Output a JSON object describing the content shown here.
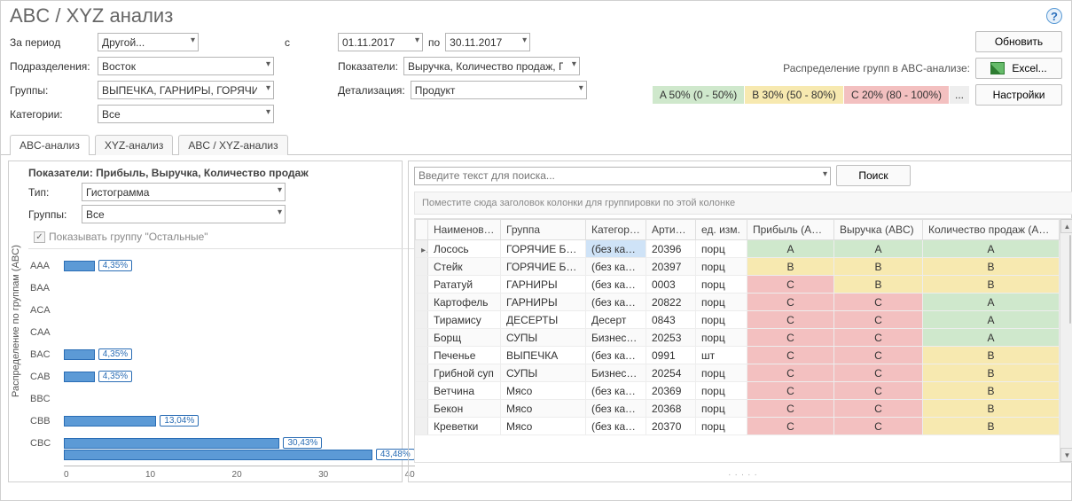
{
  "title": "ABC / XYZ анализ",
  "filters": {
    "period_label": "За период",
    "period_value": "Другой...",
    "from_label": "с",
    "from_value": "01.11.2017",
    "to_label": "по",
    "to_value": "30.11.2017",
    "division_label": "Подразделения:",
    "division_value": "Восток",
    "indicator_label": "Показатели:",
    "indicator_value": "Выручка, Количество продаж, П...",
    "groups_label": "Группы:",
    "groups_value": "ВЫПЕЧКА, ГАРНИРЫ, ГОРЯЧИЕ Б...",
    "detail_label": "Детализация:",
    "detail_value": "Продукт",
    "categories_label": "Категории:",
    "categories_value": "Все"
  },
  "abc_distribution": {
    "label": "Распределение групп в ABC-анализе:",
    "a": "A 50% (0 - 50%)",
    "b": "B 30% (50 - 80%)",
    "c": "C 20% (80 - 100%)",
    "more": "..."
  },
  "buttons": {
    "refresh": "Обновить",
    "excel": "Excel...",
    "settings": "Настройки",
    "search": "Поиск"
  },
  "tabs": [
    "ABC-анализ",
    "XYZ-анализ",
    "ABC / XYZ-анализ"
  ],
  "left_panel": {
    "vertical_label": "Распределение по группам (ABC)",
    "title": "Показатели: Прибыль, Выручка, Количество продаж",
    "type_label": "Тип:",
    "type_value": "Гистограмма",
    "groups_label": "Группы:",
    "groups_value": "Все",
    "show_other": "Показывать группу \"Остальные\""
  },
  "chart_data": {
    "type": "bar",
    "categories": [
      "AAA",
      "BAA",
      "ACA",
      "CAA",
      "BAC",
      "CAB",
      "BBC",
      "CBB",
      "CBC"
    ],
    "values": [
      4.35,
      0,
      0,
      0,
      4.35,
      4.35,
      0,
      13.04,
      30.43
    ],
    "extra_bar_value": 43.48,
    "labels": [
      "4,35%",
      "",
      "",
      "",
      "4,35%",
      "4,35%",
      "",
      "13,04%",
      "30,43%"
    ],
    "extra_label": "43,48%",
    "xlabel": "",
    "ylabel": "",
    "xlim": [
      0,
      45
    ],
    "ticks": [
      "0",
      "10",
      "20",
      "30",
      "40"
    ]
  },
  "right_panel": {
    "search_placeholder": "Введите текст для поиска...",
    "group_hint": "Поместите сюда заголовок колонки для группировки по этой колонке",
    "columns": [
      "Наименование",
      "Группа",
      "Категория",
      "Артикул",
      "ед. изм.",
      "Прибыль (ABC)",
      "Выручка (ABC)",
      "Количество продаж (ABC)"
    ],
    "rows": [
      {
        "name": "Лосось",
        "group": "ГОРЯЧИЕ БЛЮДА",
        "cat": "(без кате...",
        "art": "20396",
        "unit": "порц",
        "p": "A",
        "r": "A",
        "q": "A",
        "sel": true
      },
      {
        "name": "Стейк",
        "group": "ГОРЯЧИЕ БЛЮДА",
        "cat": "(без кате...",
        "art": "20397",
        "unit": "порц",
        "p": "B",
        "r": "B",
        "q": "B"
      },
      {
        "name": "Рататуй",
        "group": "ГАРНИРЫ",
        "cat": "(без кате...",
        "art": "0003",
        "unit": "порц",
        "p": "C",
        "r": "B",
        "q": "B"
      },
      {
        "name": "Картофель",
        "group": "ГАРНИРЫ",
        "cat": "(без кате...",
        "art": "20822",
        "unit": "порц",
        "p": "C",
        "r": "C",
        "q": "A"
      },
      {
        "name": "Тирамису",
        "group": "ДЕСЕРТЫ",
        "cat": "Десерт",
        "art": "0843",
        "unit": "порц",
        "p": "C",
        "r": "C",
        "q": "A"
      },
      {
        "name": "Борщ",
        "group": "СУПЫ",
        "cat": "Бизнес-л...",
        "art": "20253",
        "unit": "порц",
        "p": "C",
        "r": "C",
        "q": "A"
      },
      {
        "name": "Печенье",
        "group": "ВЫПЕЧКА",
        "cat": "(без кате...",
        "art": "0991",
        "unit": "шт",
        "p": "C",
        "r": "C",
        "q": "B"
      },
      {
        "name": "Грибной суп",
        "group": "СУПЫ",
        "cat": "Бизнес-л...",
        "art": "20254",
        "unit": "порц",
        "p": "C",
        "r": "C",
        "q": "B"
      },
      {
        "name": "Ветчина",
        "group": "Мясо",
        "cat": "(без кате...",
        "art": "20369",
        "unit": "порц",
        "p": "C",
        "r": "C",
        "q": "B"
      },
      {
        "name": "Бекон",
        "group": "Мясо",
        "cat": "(без кате...",
        "art": "20368",
        "unit": "порц",
        "p": "C",
        "r": "C",
        "q": "B"
      },
      {
        "name": "Креветки",
        "group": "Мясо",
        "cat": "(без кате...",
        "art": "20370",
        "unit": "порц",
        "p": "C",
        "r": "C",
        "q": "B"
      }
    ]
  }
}
